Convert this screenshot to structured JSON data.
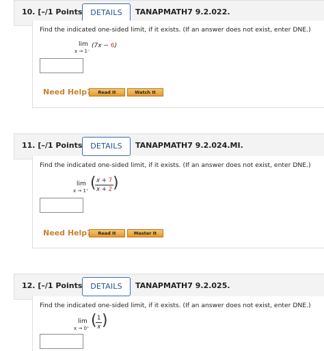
{
  "questions": [
    {
      "number": "10.  [–/1 Points]",
      "details_label": "DETAILS",
      "code": "TANAPMATH7 9.2.022.",
      "prompt": "Find the indicated one-sided limit, if it exists. (If an answer does not exist, enter DNE.)",
      "lim": "lim",
      "approach": "x → 1⁻",
      "expr_open": "(7x − ",
      "expr_red": "6",
      "expr_close": ")",
      "need_help": "Need Help?",
      "btn_read": "Read It",
      "btn_second": "Watch It"
    },
    {
      "number": "11.  [–/1 Points]",
      "details_label": "DETAILS",
      "code": "TANAPMATH7 9.2.024.MI.",
      "prompt": "Find the indicated one-sided limit, if it exists. (If an answer does not exist, enter DNE.)",
      "lim": "lim",
      "approach": "x → 1⁺",
      "num_x": "x + ",
      "num_red": "7",
      "den_x": "x + ",
      "den_red": "2",
      "need_help": "Need Help?",
      "btn_read": "Read It",
      "btn_second": "Master It"
    },
    {
      "number": "12.  [–/1 Points]",
      "details_label": "DETAILS",
      "code": "TANAPMATH7 9.2.025.",
      "prompt": "Find the indicated one-sided limit, if it exists. (If an answer does not exist, enter DNE.)",
      "lim": "lim",
      "approach": "x → 0⁺",
      "num": "1",
      "den": "x"
    }
  ],
  "colors": {
    "accent_blue": "#3b6fb0",
    "help_orange": "#c9812d",
    "button_gold": "#e79a2a",
    "highlight_red": "#c0392b"
  }
}
